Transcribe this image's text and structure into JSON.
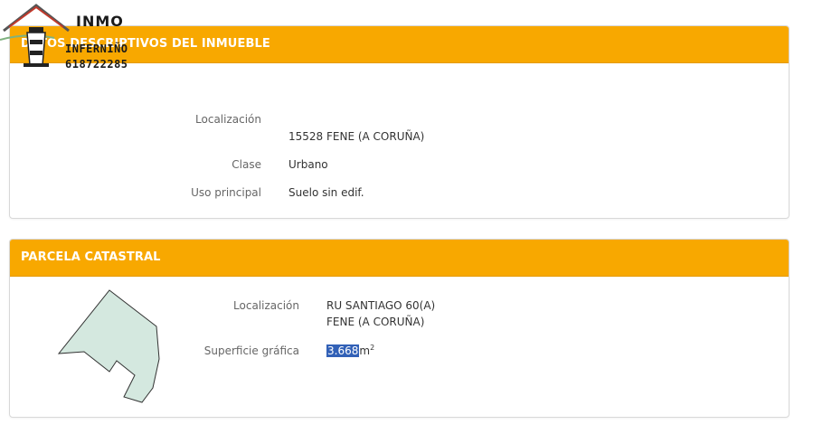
{
  "logo": {
    "title": "INMO",
    "subtitle": "INFERNIÑO",
    "phone": "618722285"
  },
  "section1": {
    "header": "DATOS DESCRIPTIVOS DEL INMUEBLE",
    "localizacion_label": "Localización",
    "localizacion_value": "15528 FENE (A CORUÑA)",
    "clase_label": "Clase",
    "clase_value": "Urbano",
    "uso_label": "Uso principal",
    "uso_value": "Suelo sin edif."
  },
  "section2": {
    "header": "PARCELA CATASTRAL",
    "localizacion_label": "Localización",
    "localizacion_line1": "RU SANTIAGO 60(A)",
    "localizacion_line2": "FENE (A CORUÑA)",
    "superficie_label": "Superficie gráfica",
    "superficie_value": "3.668",
    "superficie_unit": "m",
    "superficie_exp": "2"
  },
  "colors": {
    "header": "#f8a800",
    "parcel_fill": "#d4e8df",
    "selection": "#3261b7"
  }
}
